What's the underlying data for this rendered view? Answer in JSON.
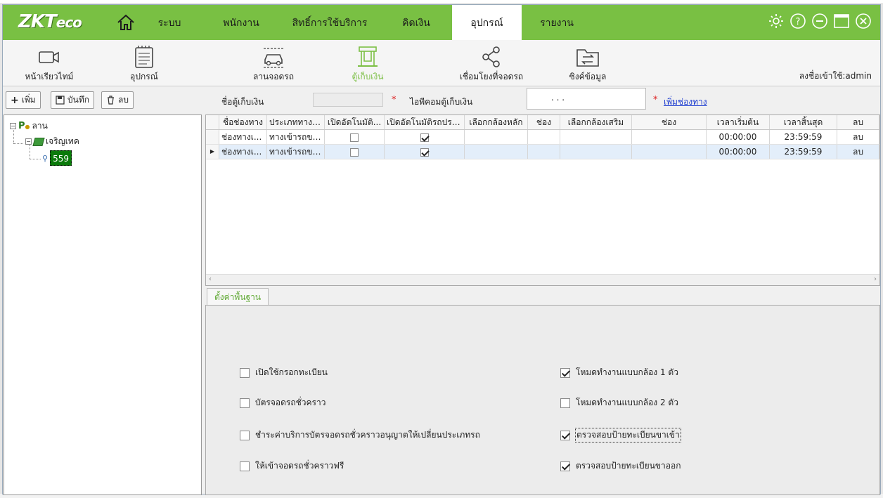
{
  "app": {
    "logo_main": "ZKT",
    "logo_sub": "eco"
  },
  "nav": {
    "items": [
      {
        "label": "ระบบ"
      },
      {
        "label": "พนักงาน"
      },
      {
        "label": "สิทธิ์การใช้บริการ"
      },
      {
        "label": "คิดเงิน"
      },
      {
        "label": "อุปกรณ์"
      },
      {
        "label": "รายงาน"
      }
    ],
    "active": "อุปกรณ์"
  },
  "toolbar": {
    "items": [
      {
        "label": "หน้าเรียวไทม์",
        "icon": "camera-icon"
      },
      {
        "label": "อุปกรณ์",
        "icon": "device-icon"
      },
      {
        "label": "ลานจอดรถ",
        "icon": "parking-lot-icon"
      },
      {
        "label": "ตู้เก็บเงิน",
        "icon": "booth-icon"
      },
      {
        "label": "เชื่อมโยงที่จอดรถ",
        "icon": "share-icon"
      },
      {
        "label": "ซิงค์ข้อมูล",
        "icon": "sync-folder-icon"
      }
    ],
    "login_text": "ลงชื่อเข้าใช้:admin"
  },
  "left": {
    "add_label": "เพิ่ม",
    "save_label": "บันทึก",
    "delete_label": "ลบ",
    "tree": {
      "root": "ลาน",
      "child": "เจริญเทค",
      "leaf": "559"
    }
  },
  "form": {
    "booth_name_label": "ชื่อตู้เก็บเงิน",
    "booth_name_value": "",
    "ip_label": "ไอพีคอมตู้เก็บเงิน",
    "ip_value": ".        .        .",
    "required_mark": "*",
    "add_lane_link": "เพิ่มช่องทาง"
  },
  "grid": {
    "columns": [
      "ชื่อช่องทาง",
      "ประเภททางเ...",
      "เปิดอัตโนมัติ...",
      "เปิดอัตโนมัติรถประจำ",
      "เลือกกล้องหลัก",
      "ช่อง",
      "เลือกกล้องเสริม",
      "ช่อง",
      "เวลาเริ่มต้น",
      "เวลาสิ้นสุด",
      "ลบ"
    ],
    "rows": [
      {
        "name": "ช่องทางเ...",
        "type": "ทางเข้ารถขน...",
        "auto_open": false,
        "auto_open_regular": true,
        "main_cam": "",
        "ch1": "",
        "aux_cam": "",
        "ch2": "",
        "start": "00:00:00",
        "end": "23:59:59",
        "del": "ลบ"
      },
      {
        "name": "ช่องทางเ...",
        "type": "ทางเข้ารถขน...",
        "auto_open": false,
        "auto_open_regular": true,
        "main_cam": "",
        "ch1": "",
        "aux_cam": "",
        "ch2": "",
        "start": "00:00:00",
        "end": "23:59:59",
        "del": "ลบ"
      }
    ]
  },
  "settings": {
    "tab_label": "ตั้งค่าพื้นฐาน",
    "left_options": [
      {
        "label": "เปิดใช้กรอกทะเบียน",
        "checked": false
      },
      {
        "label": "บัตรจอดรถชั่วคราว",
        "checked": false
      },
      {
        "label": "ชำระค่าบริการบัตรจอดรถชั่วคราวอนุญาตให้เปลี่ยนประเภทรถ",
        "checked": false
      },
      {
        "label": "ให้เข้าจอดรถชั่วคราวฟรี",
        "checked": false
      }
    ],
    "right_options": [
      {
        "label": "โหมดทำงานแบบกล้อง 1 ตัว",
        "checked": true
      },
      {
        "label": "โหมดทำงานแบบกล้อง 2 ตัว",
        "checked": false
      },
      {
        "label": "ตรวจสอบป้ายทะเบียนขาเข้า",
        "checked": true
      },
      {
        "label": "ตรวจสอบป้ายทะเบียนขาออก",
        "checked": true
      }
    ]
  },
  "colors": {
    "brand_green": "#79c043",
    "link_blue": "#1a3ad0",
    "required_red": "#d22222"
  }
}
